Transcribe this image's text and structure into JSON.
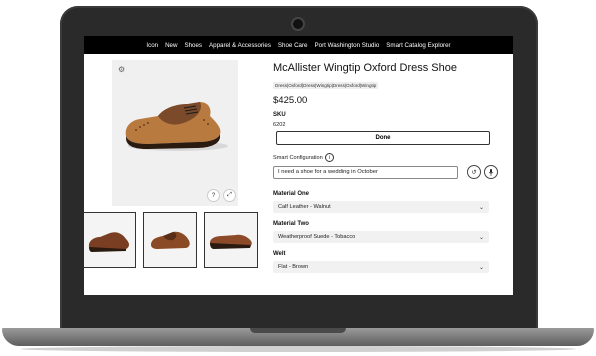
{
  "nav": {
    "items": [
      "Icon",
      "New",
      "Shoes",
      "Apparel & Accessories",
      "Shoe Care",
      "Port Washington Studio",
      "Smart Catalog Explorer"
    ]
  },
  "product": {
    "title": "McAllister Wingtip Oxford Dress Shoe",
    "breadcrumb": "Dress|Oxford|Dress|Wingtip|Dress|Oxford|Wingtip",
    "price": "$425.00",
    "sku_label": "SKU",
    "sku_value": "6202",
    "done_label": "Done",
    "smart_config_label": "Smart Configuration",
    "smart_config_value": "I need a shoe for a wedding in October",
    "options": [
      {
        "label": "Material One",
        "value": "Calf Leather - Walnut"
      },
      {
        "label": "Material Two",
        "value": "Weatherproof Suede - Tobacco"
      },
      {
        "label": "Welt",
        "value": "Flat - Brown"
      }
    ]
  },
  "gallery": {
    "help_glyph": "?",
    "expand_glyph": "⤢",
    "settings_glyph": "⚙"
  },
  "icons": {
    "info": "i",
    "reset": "↺",
    "mic": "●",
    "chevron": "⌄"
  },
  "colors": {
    "nav_bg": "#000000",
    "gallery_bg": "#f0f0f0",
    "select_bg": "#f1f1f1",
    "shoe_tan": "#b87a3e",
    "shoe_brown": "#7a3f22"
  }
}
